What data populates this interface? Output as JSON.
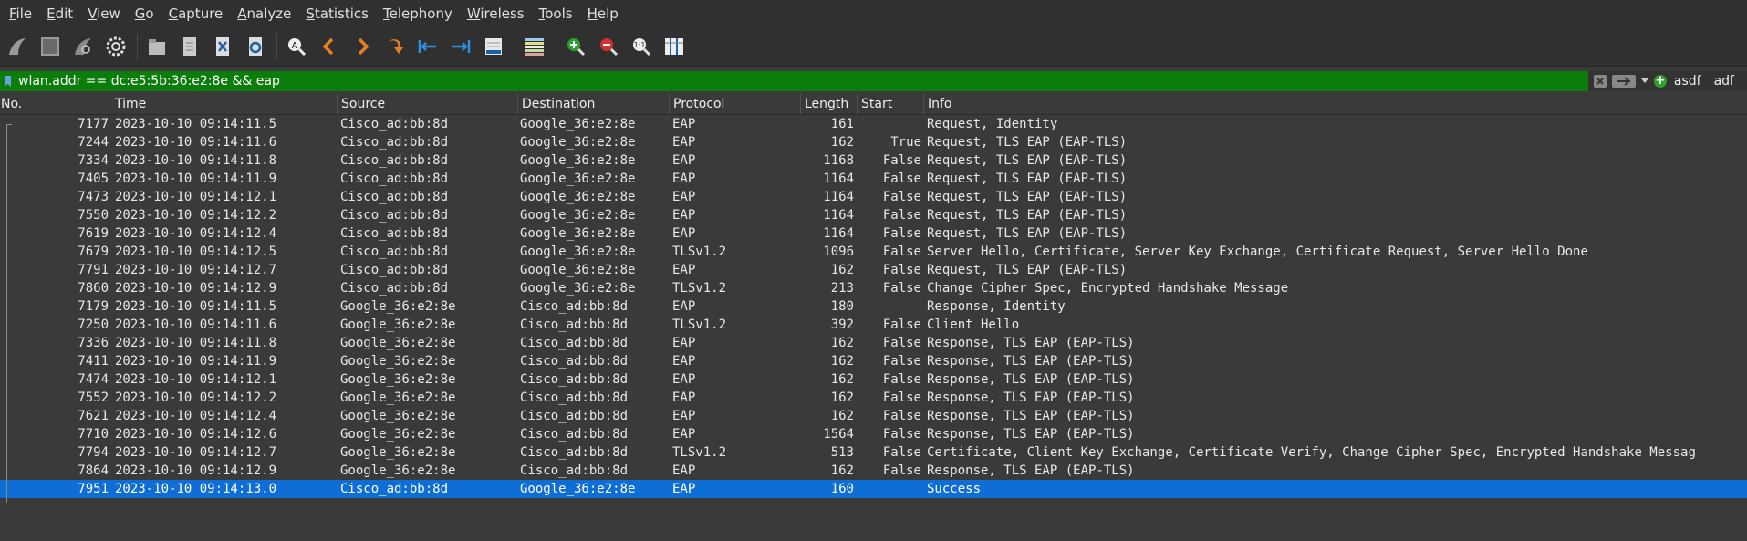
{
  "menu": [
    {
      "label": "File",
      "u": "F",
      "rest": "ile"
    },
    {
      "label": "Edit",
      "u": "E",
      "rest": "dit"
    },
    {
      "label": "View",
      "u": "V",
      "rest": "iew"
    },
    {
      "label": "Go",
      "u": "G",
      "rest": "o"
    },
    {
      "label": "Capture",
      "u": "C",
      "rest": "apture"
    },
    {
      "label": "Analyze",
      "u": "A",
      "rest": "nalyze"
    },
    {
      "label": "Statistics",
      "u": "S",
      "rest": "tatistics"
    },
    {
      "label": "Telephony",
      "u": "T",
      "rest": "elephony"
    },
    {
      "label": "Wireless",
      "u": "W",
      "rest": "ireless"
    },
    {
      "label": "Tools",
      "u": "T",
      "rest": "ools"
    },
    {
      "label": "Help",
      "u": "H",
      "rest": "elp"
    }
  ],
  "toolbar_icons": [
    "shark-fin-start-icon",
    "stop-square-icon",
    "restart-fin-icon",
    "gear-options-icon",
    "open-folder-icon",
    "file-save-icon",
    "close-file-icon",
    "reload-icon",
    "find-packet-icon",
    "go-back-icon",
    "go-forward-icon",
    "go-to-packet-icon",
    "first-packet-icon",
    "last-packet-icon",
    "autoscroll-icon",
    "colorize-icon",
    "zoom-in-icon",
    "zoom-out-icon",
    "zoom-normal-icon",
    "resize-columns-icon"
  ],
  "filter": {
    "text": "wlan.addr == dc:e5:5b:36:e2:8e && eap",
    "buttons": [
      "asdf",
      "adf"
    ]
  },
  "columns": {
    "no": "No.",
    "time": "Time",
    "source": "Source",
    "destination": "Destination",
    "protocol": "Protocol",
    "length": "Length",
    "start": "Start",
    "info": "Info"
  },
  "packets": [
    {
      "no": "7177",
      "time": "2023-10-10 09:14:11.5",
      "source": "Cisco_ad:bb:8d",
      "destination": "Google_36:e2:8e",
      "protocol": "EAP",
      "length": "161",
      "start": "",
      "info": "Request, Identity"
    },
    {
      "no": "7244",
      "time": "2023-10-10 09:14:11.6",
      "source": "Cisco_ad:bb:8d",
      "destination": "Google_36:e2:8e",
      "protocol": "EAP",
      "length": "162",
      "start": "True",
      "info": "Request, TLS EAP (EAP-TLS)"
    },
    {
      "no": "7334",
      "time": "2023-10-10 09:14:11.8",
      "source": "Cisco_ad:bb:8d",
      "destination": "Google_36:e2:8e",
      "protocol": "EAP",
      "length": "1168",
      "start": "False",
      "info": "Request, TLS EAP (EAP-TLS)"
    },
    {
      "no": "7405",
      "time": "2023-10-10 09:14:11.9",
      "source": "Cisco_ad:bb:8d",
      "destination": "Google_36:e2:8e",
      "protocol": "EAP",
      "length": "1164",
      "start": "False",
      "info": "Request, TLS EAP (EAP-TLS)"
    },
    {
      "no": "7473",
      "time": "2023-10-10 09:14:12.1",
      "source": "Cisco_ad:bb:8d",
      "destination": "Google_36:e2:8e",
      "protocol": "EAP",
      "length": "1164",
      "start": "False",
      "info": "Request, TLS EAP (EAP-TLS)"
    },
    {
      "no": "7550",
      "time": "2023-10-10 09:14:12.2",
      "source": "Cisco_ad:bb:8d",
      "destination": "Google_36:e2:8e",
      "protocol": "EAP",
      "length": "1164",
      "start": "False",
      "info": "Request, TLS EAP (EAP-TLS)"
    },
    {
      "no": "7619",
      "time": "2023-10-10 09:14:12.4",
      "source": "Cisco_ad:bb:8d",
      "destination": "Google_36:e2:8e",
      "protocol": "EAP",
      "length": "1164",
      "start": "False",
      "info": "Request, TLS EAP (EAP-TLS)"
    },
    {
      "no": "7679",
      "time": "2023-10-10 09:14:12.5",
      "source": "Cisco_ad:bb:8d",
      "destination": "Google_36:e2:8e",
      "protocol": "TLSv1.2",
      "length": "1096",
      "start": "False",
      "info": "Server Hello, Certificate, Server Key Exchange, Certificate Request, Server Hello Done"
    },
    {
      "no": "7791",
      "time": "2023-10-10 09:14:12.7",
      "source": "Cisco_ad:bb:8d",
      "destination": "Google_36:e2:8e",
      "protocol": "EAP",
      "length": "162",
      "start": "False",
      "info": "Request, TLS EAP (EAP-TLS)"
    },
    {
      "no": "7860",
      "time": "2023-10-10 09:14:12.9",
      "source": "Cisco_ad:bb:8d",
      "destination": "Google_36:e2:8e",
      "protocol": "TLSv1.2",
      "length": "213",
      "start": "False",
      "info": "Change Cipher Spec, Encrypted Handshake Message"
    },
    {
      "no": "7179",
      "time": "2023-10-10 09:14:11.5",
      "source": "Google_36:e2:8e",
      "destination": "Cisco_ad:bb:8d",
      "protocol": "EAP",
      "length": "180",
      "start": "",
      "info": "Response, Identity"
    },
    {
      "no": "7250",
      "time": "2023-10-10 09:14:11.6",
      "source": "Google_36:e2:8e",
      "destination": "Cisco_ad:bb:8d",
      "protocol": "TLSv1.2",
      "length": "392",
      "start": "False",
      "info": "Client Hello"
    },
    {
      "no": "7336",
      "time": "2023-10-10 09:14:11.8",
      "source": "Google_36:e2:8e",
      "destination": "Cisco_ad:bb:8d",
      "protocol": "EAP",
      "length": "162",
      "start": "False",
      "info": "Response, TLS EAP (EAP-TLS)"
    },
    {
      "no": "7411",
      "time": "2023-10-10 09:14:11.9",
      "source": "Google_36:e2:8e",
      "destination": "Cisco_ad:bb:8d",
      "protocol": "EAP",
      "length": "162",
      "start": "False",
      "info": "Response, TLS EAP (EAP-TLS)"
    },
    {
      "no": "7474",
      "time": "2023-10-10 09:14:12.1",
      "source": "Google_36:e2:8e",
      "destination": "Cisco_ad:bb:8d",
      "protocol": "EAP",
      "length": "162",
      "start": "False",
      "info": "Response, TLS EAP (EAP-TLS)"
    },
    {
      "no": "7552",
      "time": "2023-10-10 09:14:12.2",
      "source": "Google_36:e2:8e",
      "destination": "Cisco_ad:bb:8d",
      "protocol": "EAP",
      "length": "162",
      "start": "False",
      "info": "Response, TLS EAP (EAP-TLS)"
    },
    {
      "no": "7621",
      "time": "2023-10-10 09:14:12.4",
      "source": "Google_36:e2:8e",
      "destination": "Cisco_ad:bb:8d",
      "protocol": "EAP",
      "length": "162",
      "start": "False",
      "info": "Response, TLS EAP (EAP-TLS)"
    },
    {
      "no": "7710",
      "time": "2023-10-10 09:14:12.6",
      "source": "Google_36:e2:8e",
      "destination": "Cisco_ad:bb:8d",
      "protocol": "EAP",
      "length": "1564",
      "start": "False",
      "info": "Response, TLS EAP (EAP-TLS)"
    },
    {
      "no": "7794",
      "time": "2023-10-10 09:14:12.7",
      "source": "Google_36:e2:8e",
      "destination": "Cisco_ad:bb:8d",
      "protocol": "TLSv1.2",
      "length": "513",
      "start": "False",
      "info": "Certificate, Client Key Exchange, Certificate Verify, Change Cipher Spec, Encrypted Handshake Messag"
    },
    {
      "no": "7864",
      "time": "2023-10-10 09:14:12.9",
      "source": "Google_36:e2:8e",
      "destination": "Cisco_ad:bb:8d",
      "protocol": "EAP",
      "length": "162",
      "start": "False",
      "info": "Response, TLS EAP (EAP-TLS)"
    },
    {
      "no": "7951",
      "time": "2023-10-10 09:14:13.0",
      "source": "Cisco_ad:bb:8d",
      "destination": "Google_36:e2:8e",
      "protocol": "EAP",
      "length": "160",
      "start": "",
      "info": "Success",
      "selected": true
    }
  ],
  "colors": {
    "filter_valid": "#0a7d0a",
    "selection": "#0f6ed6",
    "background": "#3a3a3a"
  }
}
